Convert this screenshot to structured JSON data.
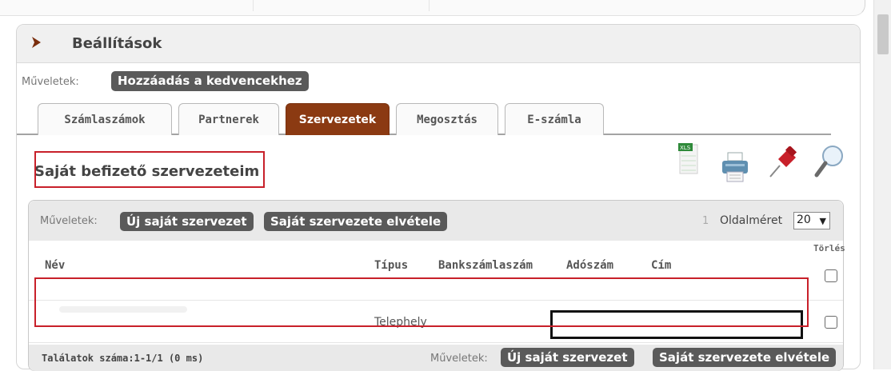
{
  "panel": {
    "title": "Beállítások"
  },
  "favorites": {
    "label": "Műveletek:",
    "add_button": "Hozzáadás a kedvencekhez"
  },
  "tabs": [
    {
      "label": "Számlaszámok",
      "active": false
    },
    {
      "label": "Partnerek",
      "active": false
    },
    {
      "label": "Szervezetek",
      "active": true
    },
    {
      "label": "Megosztás",
      "active": false
    },
    {
      "label": "E-számla",
      "active": false
    }
  ],
  "section": {
    "title": "Saját befizető szervezeteim"
  },
  "toolbar_icons": [
    "excel-export-icon",
    "print-icon",
    "pin-icon",
    "search-icon"
  ],
  "list": {
    "actions_label": "Műveletek:",
    "new_button": "Új saját szervezet",
    "remove_button": "Saját szervezete elvétele",
    "page_number": "1",
    "page_size_label": "Oldalméret",
    "page_size_value": "20",
    "columns": [
      "Név",
      "Típus",
      "Bankszámlaszám",
      "Adószám",
      "Cím"
    ],
    "delete_header": "Törlés",
    "rows": [
      {
        "name": "",
        "type": "Telephely",
        "bank_account": "",
        "tax_number": "",
        "address": ""
      }
    ],
    "results_text": "Találatok száma:1-1/1 (0 ms)"
  },
  "colors": {
    "active_tab": "#8b3a12",
    "highlight_red": "#c8202a",
    "button_dark": "#5a5a5a"
  }
}
